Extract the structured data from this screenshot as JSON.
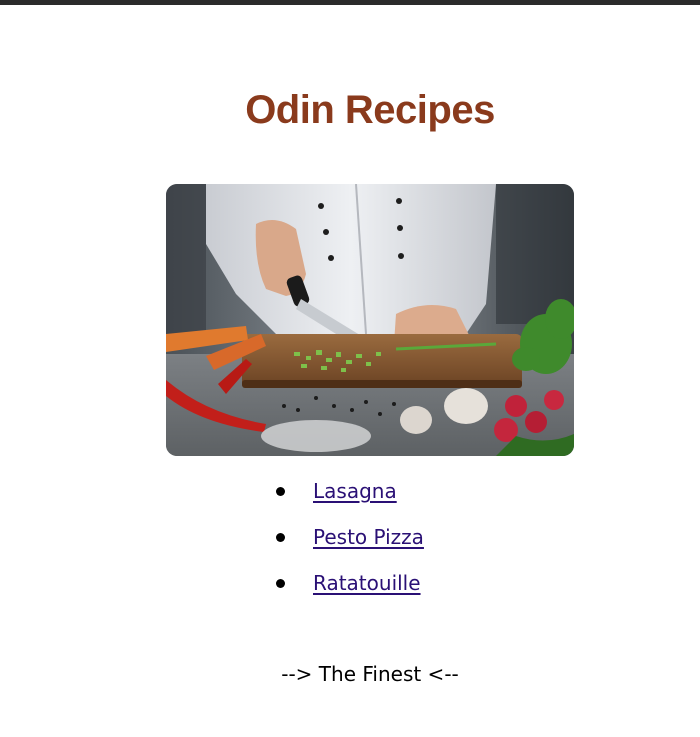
{
  "header": {
    "title": "Odin Recipes"
  },
  "hero": {
    "description_icon": "chef-cutting-vegetables-photo"
  },
  "recipes": [
    {
      "label": "Lasagna"
    },
    {
      "label": "Pesto Pizza"
    },
    {
      "label": "Ratatouille"
    }
  ],
  "footer": {
    "text": "--> The Finest <--"
  },
  "colors": {
    "title": "#8a3a1c",
    "link": "#2a1075"
  }
}
